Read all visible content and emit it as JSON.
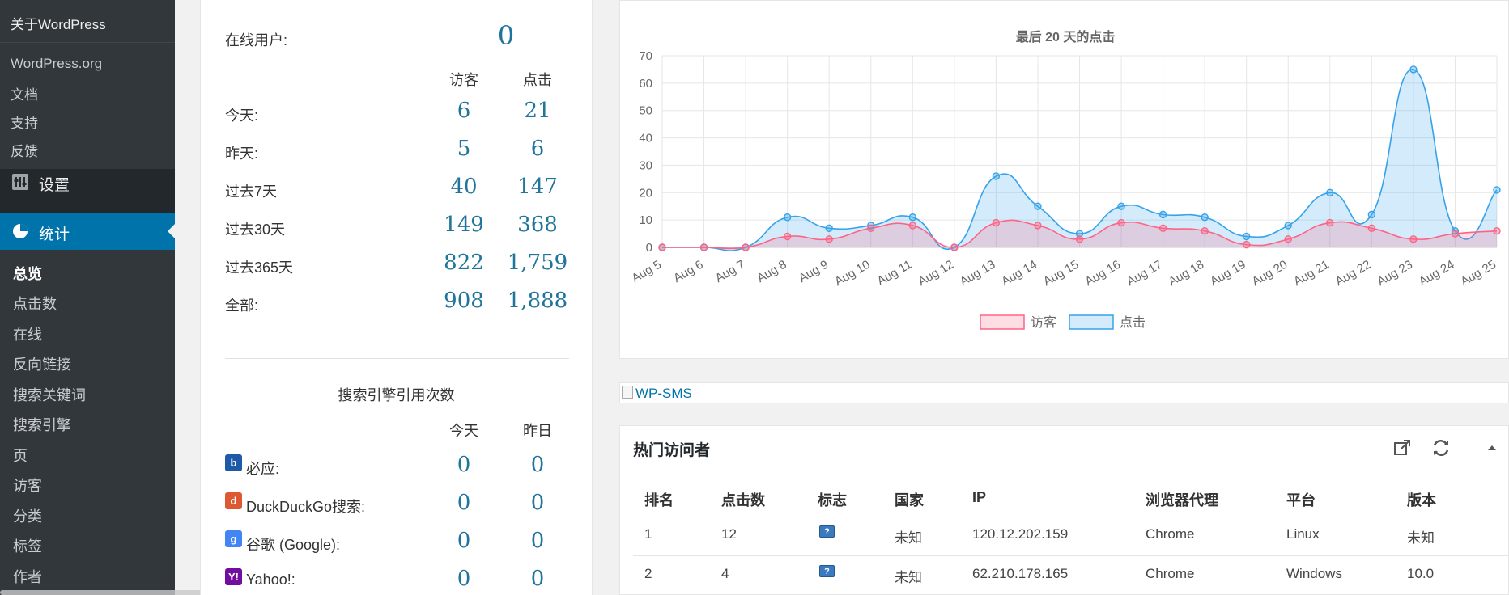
{
  "sidebar": {
    "flyout": {
      "title": "关于WordPress",
      "links": [
        "WordPress.org",
        "文档",
        "支持",
        "反馈"
      ]
    },
    "settings_label": "设置",
    "stats_label": "统计",
    "submenu": [
      "总览",
      "点击数",
      "在线",
      "反向链接",
      "搜索关键词",
      "搜索引擎",
      "页",
      "访客",
      "分类",
      "标签",
      "作者"
    ]
  },
  "summary": {
    "online_label": "在线用户:",
    "online_value": "0",
    "col_visitors": "访客",
    "col_visits": "点击",
    "rows": [
      {
        "label": "今天:",
        "visitors": "6",
        "visits": "21"
      },
      {
        "label": "昨天:",
        "visitors": "5",
        "visits": "6"
      },
      {
        "label": "过去7天",
        "visitors": "40",
        "visits": "147"
      },
      {
        "label": "过去30天",
        "visitors": "149",
        "visits": "368"
      },
      {
        "label": "过去365天",
        "visitors": "822",
        "visits": "1,759"
      },
      {
        "label": "全部:",
        "visitors": "908",
        "visits": "1,888"
      }
    ]
  },
  "search_engines": {
    "title": "搜索引擎引用次数",
    "col_today": "今天",
    "col_yesterday": "昨日",
    "rows": [
      {
        "label": "必应:",
        "today": "0",
        "yesterday": "0",
        "icon": "bing-icon",
        "color": "#1e5aa8"
      },
      {
        "label": "DuckDuckGo搜索:",
        "today": "0",
        "yesterday": "0",
        "icon": "duckduckgo-icon",
        "color": "#de5833"
      },
      {
        "label": "谷歌 (Google):",
        "today": "0",
        "yesterday": "0",
        "icon": "google-icon",
        "color": "#4285f4"
      },
      {
        "label": "Yahoo!:",
        "today": "0",
        "yesterday": "0",
        "icon": "yahoo-icon",
        "color": "#720e9e"
      }
    ]
  },
  "chart_data": {
    "type": "line",
    "title": "最后 20 天的点击",
    "categories": [
      "Aug 5",
      "Aug 6",
      "Aug 7",
      "Aug 8",
      "Aug 9",
      "Aug 10",
      "Aug 11",
      "Aug 12",
      "Aug 13",
      "Aug 14",
      "Aug 15",
      "Aug 16",
      "Aug 17",
      "Aug 18",
      "Aug 19",
      "Aug 20",
      "Aug 21",
      "Aug 22",
      "Aug 23",
      "Aug 24",
      "Aug 25"
    ],
    "series": [
      {
        "name": "访客",
        "color": "#ff6384",
        "values": [
          0,
          0,
          0,
          4,
          3,
          7,
          8,
          0,
          9,
          8,
          3,
          9,
          7,
          6,
          1,
          3,
          9,
          7,
          3,
          5,
          6
        ]
      },
      {
        "name": "点击",
        "color": "#36a2eb",
        "values": [
          0,
          0,
          0,
          11,
          7,
          8,
          11,
          0,
          26,
          15,
          5,
          15,
          12,
          11,
          4,
          8,
          20,
          12,
          65,
          6,
          21
        ]
      }
    ],
    "ylim": [
      0,
      70
    ],
    "yticks": [
      0,
      10,
      20,
      30,
      40,
      50,
      60,
      70
    ],
    "grid": true,
    "legend": "bottom"
  },
  "banner": {
    "alt_text": "WP-SMS"
  },
  "top_visitors": {
    "title": "热门访问者",
    "columns": [
      "排名",
      "点击数",
      "标志",
      "国家",
      "IP",
      "浏览器代理",
      "平台",
      "版本"
    ],
    "rows": [
      {
        "rank": "1",
        "hits": "12",
        "flag": "?",
        "country": "未知",
        "ip": "120.12.202.159",
        "agent": "Chrome",
        "platform": "Linux",
        "version": "未知"
      },
      {
        "rank": "2",
        "hits": "4",
        "flag": "?",
        "country": "未知",
        "ip": "62.210.178.165",
        "agent": "Chrome",
        "platform": "Windows",
        "version": "10.0"
      }
    ]
  }
}
